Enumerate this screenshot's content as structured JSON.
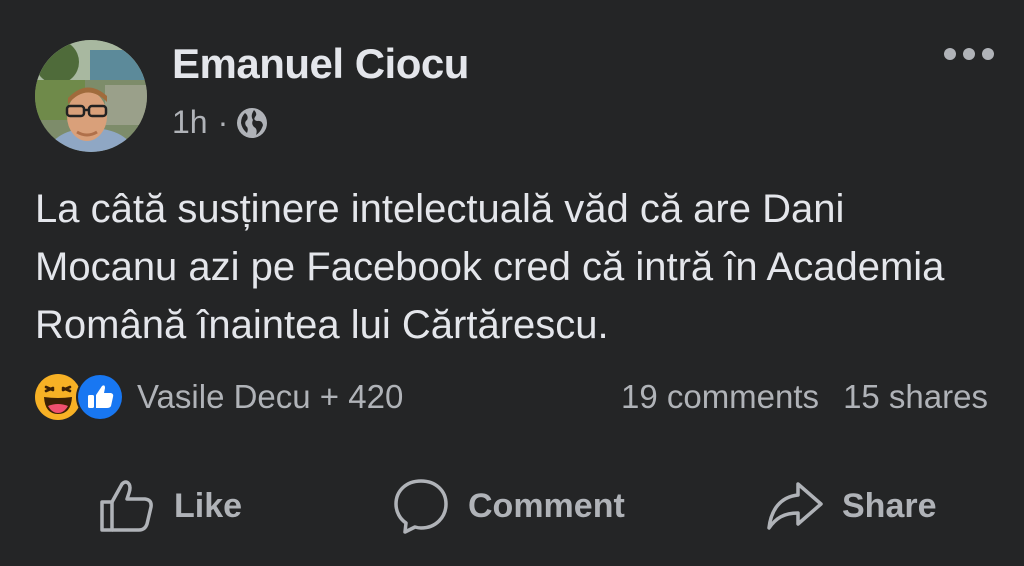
{
  "post": {
    "author": "Emanuel Ciocu",
    "time": "1h",
    "separator": "·",
    "audience_icon": "globe-icon",
    "text": "La câtă susținere intelectuală văd că are Dani Mocanu azi pe Facebook cred că intră în Academia Română înaintea lui Cărtărescu."
  },
  "reactions": {
    "icons": [
      "haha-emoji-icon",
      "like-emoji-icon"
    ],
    "summary": "Vasile Decu + 420",
    "comments": "19 comments",
    "shares": "15 shares"
  },
  "actions": {
    "like": "Like",
    "comment": "Comment",
    "share": "Share"
  },
  "colors": {
    "background": "#242526",
    "primary_text": "#e4e6eb",
    "secondary_text": "#b0b3b8",
    "like_blue": "#1877f2",
    "haha_yellow": "#f7b125"
  }
}
